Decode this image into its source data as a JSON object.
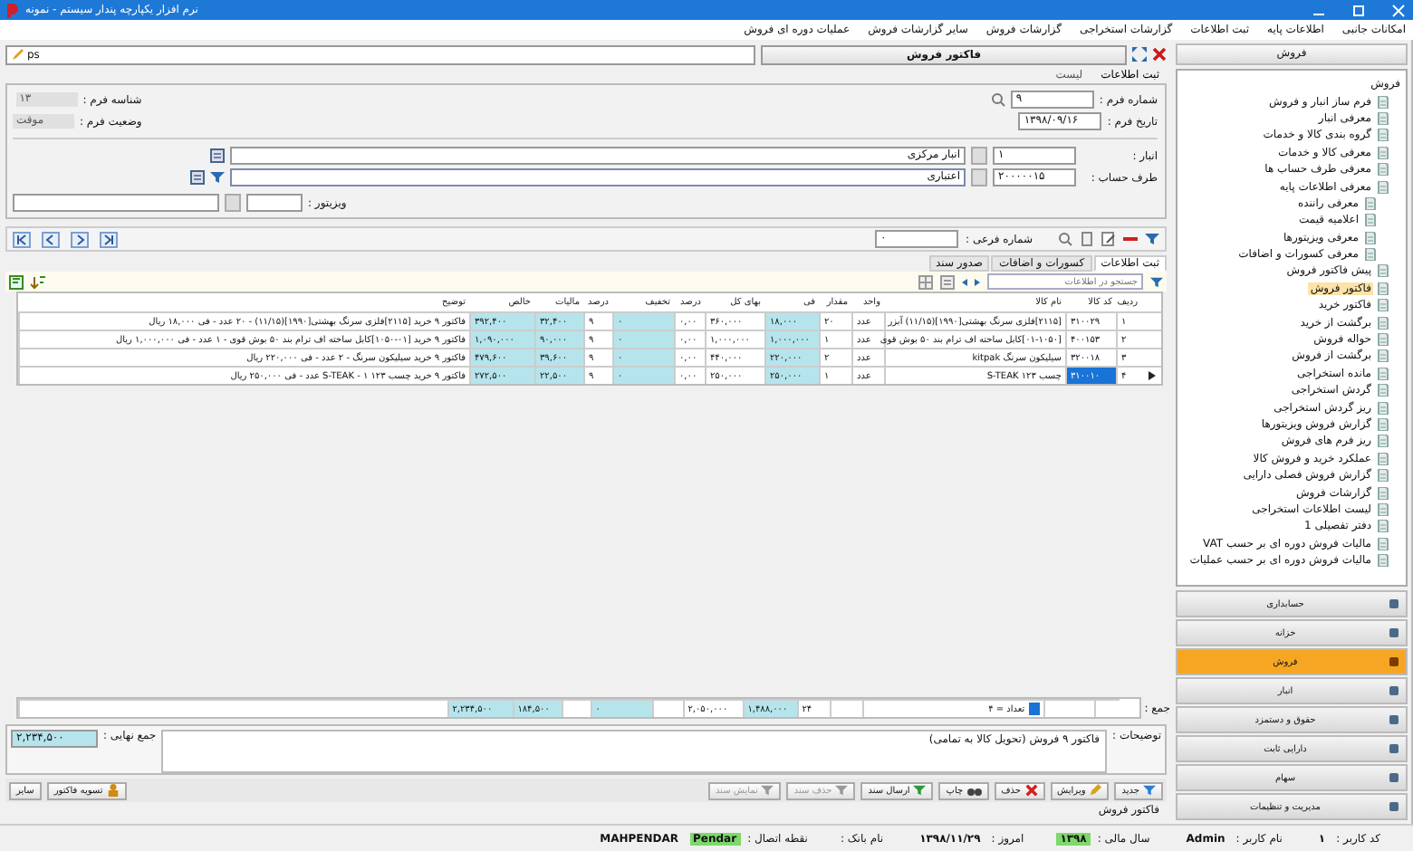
{
  "window": {
    "title": "نرم افزار یکپارچه پندار سیستم - نمونه"
  },
  "menu": [
    "امکانات جانبی",
    "اطلاعات پایه",
    "ثبت اطلاعات",
    "گزارشات استخراجی",
    "گزارشات فروش",
    "سایر گزارشات فروش",
    "عملیات دوره ای فروش"
  ],
  "form": {
    "title": "فاکتور فروش",
    "path_value": "ps",
    "mode_tabs": [
      {
        "label": "ثبت اطلاعات",
        "selected": true
      },
      {
        "label": "لیست",
        "selected": false
      }
    ],
    "fields_right": [
      {
        "label": "شماره فرم :",
        "value": "۹"
      },
      {
        "label": "تاریخ فرم :",
        "value": "۱۳۹۸/۰۹/۱۶"
      }
    ],
    "fields_left": [
      {
        "label": "شناسه فرم :",
        "value": "۱۳"
      },
      {
        "label": "وضعیت فرم :",
        "value": "موقت"
      }
    ],
    "lookups": [
      {
        "label": "انبار :",
        "code": "۱",
        "name": "انبار مرکزی",
        "filter": false
      },
      {
        "label": "طرف حساب :",
        "code": "۲۰۰۰۰۰۱۵",
        "name": "اعتباری",
        "filter": true
      }
    ],
    "visitor": {
      "label": "ویزیتور :"
    },
    "sub_number": {
      "label": "شماره فرعی :",
      "value": "۰"
    }
  },
  "grid": {
    "tabs": [
      {
        "label": "ثبت اطلاعات",
        "selected": true
      },
      {
        "label": "کسورات و اضافات",
        "selected": false
      },
      {
        "label": "صدور سند",
        "selected": false
      }
    ],
    "search": {
      "placeholder": "جستجو در اطلاعات"
    },
    "columns": [
      {
        "label": "ردیف",
        "shaded": false
      },
      {
        "label": "کد کالا",
        "shaded": false
      },
      {
        "label": "نام کالا",
        "shaded": false
      },
      {
        "label": "واحد",
        "shaded": false
      },
      {
        "label": "مقدار",
        "shaded": false
      },
      {
        "label": "فی",
        "shaded": true
      },
      {
        "label": "بهای کل",
        "shaded": false
      },
      {
        "label": "درصد",
        "shaded": false
      },
      {
        "label": "تخفیف",
        "shaded": true
      },
      {
        "label": "درصد",
        "shaded": false
      },
      {
        "label": "مالیات",
        "shaded": true
      },
      {
        "label": "خالص",
        "shaded": true
      },
      {
        "label": "توضیح",
        "shaded": false
      }
    ],
    "rows": [
      {
        "selected": false,
        "cells": [
          "۱",
          "۳۱۰۰۲۹",
          "[۲۱۱۵]فلزی سرنگ بهشتی[۱۹۹۰](۱۱/۱۵) آبزر",
          "عدد",
          "۲۰",
          "۱۸,۰۰۰",
          "۳۶۰,۰۰۰",
          "۰,۰۰",
          "۰",
          "۹",
          "۳۲,۴۰۰",
          "۳۹۲,۴۰۰",
          "فاکتور ۹ خرید [۲۱۱۵]فلزی سرنگ بهشتی[۱۹۹۰](۱۱/۱۵) - ۲۰ عدد - فی ۱۸,۰۰۰ ریال"
        ]
      },
      {
        "selected": false,
        "cells": [
          "۲",
          "۴۰۰۱۵۳",
          "[۰۱-۱۰۵۰]کابل ساخته اف ترام بند ۵۰ بوش قوی",
          "عدد",
          "۱",
          "۱,۰۰۰,۰۰۰",
          "۱,۰۰۰,۰۰۰",
          "۰,۰۰",
          "۰",
          "۹",
          "۹۰,۰۰۰",
          "۱,۰۹۰,۰۰۰",
          "فاکتور ۹ خرید [۰۱-۱۰۵۰]کابل ساخته اف ترام بند ۵۰ بوش قوی - ۱ عدد - فی ۱,۰۰۰,۰۰۰ ریال"
        ]
      },
      {
        "selected": false,
        "cells": [
          "۳",
          "۳۲۰۰۱۸",
          "سیلیکون سرنگ kitpak",
          "عدد",
          "۲",
          "۲۲۰,۰۰۰",
          "۴۴۰,۰۰۰",
          "۰,۰۰",
          "۰",
          "۹",
          "۳۹,۶۰۰",
          "۴۷۹,۶۰۰",
          "فاکتور ۹ خرید سیلیکون سرنگ - ۲ عدد - فی ۲۲۰,۰۰۰ ریال"
        ]
      },
      {
        "selected": true,
        "cells": [
          "۴",
          "۳۱۰۰۱۰",
          "چسب ۱۲۳ S-TEAK",
          "عدد",
          "۱",
          "۲۵۰,۰۰۰",
          "۲۵۰,۰۰۰",
          "۰,۰۰",
          "۰",
          "۹",
          "۲۲,۵۰۰",
          "۲۷۲,۵۰۰",
          "فاکتور ۹ خرید چسب ۱۲۳ S-TEAK - ۱ عدد - فی ۲۵۰,۰۰۰ ریال"
        ]
      }
    ],
    "totals": {
      "label": "جمع :",
      "count": "تعداد = ۴",
      "cells": [
        null,
        null,
        null,
        null,
        "۲۴",
        "۱,۴۸۸,۰۰۰",
        "۲,۰۵۰,۰۰۰",
        null,
        "۰",
        null,
        "۱۸۴,۵۰۰",
        "۲,۲۳۴,۵۰۰",
        null
      ]
    }
  },
  "description": {
    "label": "توضیحات :",
    "value": "فاکتور ۹ فروش (تحویل کالا به تمامی)"
  },
  "final_total": {
    "label": "جمع نهایی :",
    "value": "۲,۲۳۴,۵۰۰"
  },
  "buttons": [
    {
      "label": "جدید",
      "kind": "new",
      "disabled": false
    },
    {
      "label": "ویرایش",
      "kind": "edit",
      "disabled": false
    },
    {
      "label": "حذف",
      "kind": "delete",
      "disabled": false
    },
    {
      "label": "چاپ",
      "kind": "print",
      "disabled": false
    },
    {
      "label": "ارسال سند",
      "kind": "send",
      "disabled": false
    },
    {
      "label": "حذف سند",
      "kind": "remove",
      "disabled": true
    },
    {
      "label": "نمایش سند",
      "kind": "show",
      "disabled": true
    },
    {
      "label": "تسویه فاکتور",
      "kind": "settle",
      "disabled": false
    },
    {
      "label": "سایر",
      "kind": "other",
      "disabled": false
    }
  ],
  "form_status": "فاکتور فروش",
  "sidebar": {
    "title": "فروش",
    "tree": [
      {
        "label": "فروش",
        "selected": false,
        "children": [
          {
            "label": "فرم ساز انبار و فروش",
            "selected": false
          },
          {
            "label": "معرفی انبار",
            "selected": false
          },
          {
            "label": "گروه بندی کالا و خدمات",
            "selected": false
          },
          {
            "label": "معرفی کالا و خدمات",
            "selected": false
          },
          {
            "label": "معرفی طرف حساب ها",
            "selected": false
          },
          {
            "label": "معرفی اطلاعات پایه",
            "selected": false,
            "children": [
              {
                "label": "معرفی راننده",
                "selected": false
              },
              {
                "label": "اعلامیه قیمت",
                "selected": false
              },
              {
                "label": "معرفی ویزیتورها",
                "selected": false
              },
              {
                "label": "معرفی کسورات و اضافات",
                "selected": false
              }
            ]
          },
          {
            "label": "پیش فاکتور فروش",
            "selected": false
          },
          {
            "label": "فاکتور فروش",
            "selected": true
          },
          {
            "label": "فاکتور خرید",
            "selected": false
          },
          {
            "label": "برگشت از خرید",
            "selected": false
          },
          {
            "label": "حواله فروش",
            "selected": false
          },
          {
            "label": "برگشت از فروش",
            "selected": false
          },
          {
            "label": "مانده استخراجی",
            "selected": false
          },
          {
            "label": "گردش استخراجی",
            "selected": false
          },
          {
            "label": "ریز گردش استخراجی",
            "selected": false
          },
          {
            "label": "گزارش فروش ویزیتورها",
            "selected": false
          },
          {
            "label": "ریز فرم های فروش",
            "selected": false
          },
          {
            "label": "عملکرد خرید و فروش کالا",
            "selected": false
          },
          {
            "label": "گزارش فروش فصلی دارایی",
            "selected": false
          },
          {
            "label": "گزارشات فروش",
            "selected": false
          },
          {
            "label": "لیست اطلاعات استخراجی",
            "selected": false
          },
          {
            "label": "دفتر تفصیلی 1",
            "selected": false
          },
          {
            "label": "مالیات فروش دوره ای بر حسب VAT",
            "selected": false
          },
          {
            "label": "مالیات فروش دوره ای بر حسب عملیات",
            "selected": false
          }
        ]
      }
    ],
    "modules": [
      {
        "label": "حسابداری",
        "selected": false
      },
      {
        "label": "خزانه",
        "selected": false
      },
      {
        "label": "فروش",
        "selected": true
      },
      {
        "label": "انبار",
        "selected": false
      },
      {
        "label": "حقوق و دستمزد",
        "selected": false
      },
      {
        "label": "دارایی ثابت",
        "selected": false
      },
      {
        "label": "سهام",
        "selected": false
      },
      {
        "label": "مدیریت و تنظیمات",
        "selected": false
      }
    ]
  },
  "status_bar": [
    {
      "label": "کد کاربر :",
      "value": "۱",
      "highlight": false
    },
    {
      "label": "نام کاربر :",
      "value": "Admin",
      "highlight": false
    },
    {
      "label": "سال مالی :",
      "value": "۱۳۹۸",
      "highlight": true
    },
    {
      "label": "امروز :",
      "value": "۱۳۹۸/۱۱/۲۹",
      "highlight": false
    },
    {
      "label": "نام بانک :",
      "highlight": false
    },
    {
      "label": "نقطه اتصال :",
      "value": "Pendar",
      "highlight": true
    },
    {
      "value": "MAHPENDAR",
      "highlight": false
    }
  ]
}
